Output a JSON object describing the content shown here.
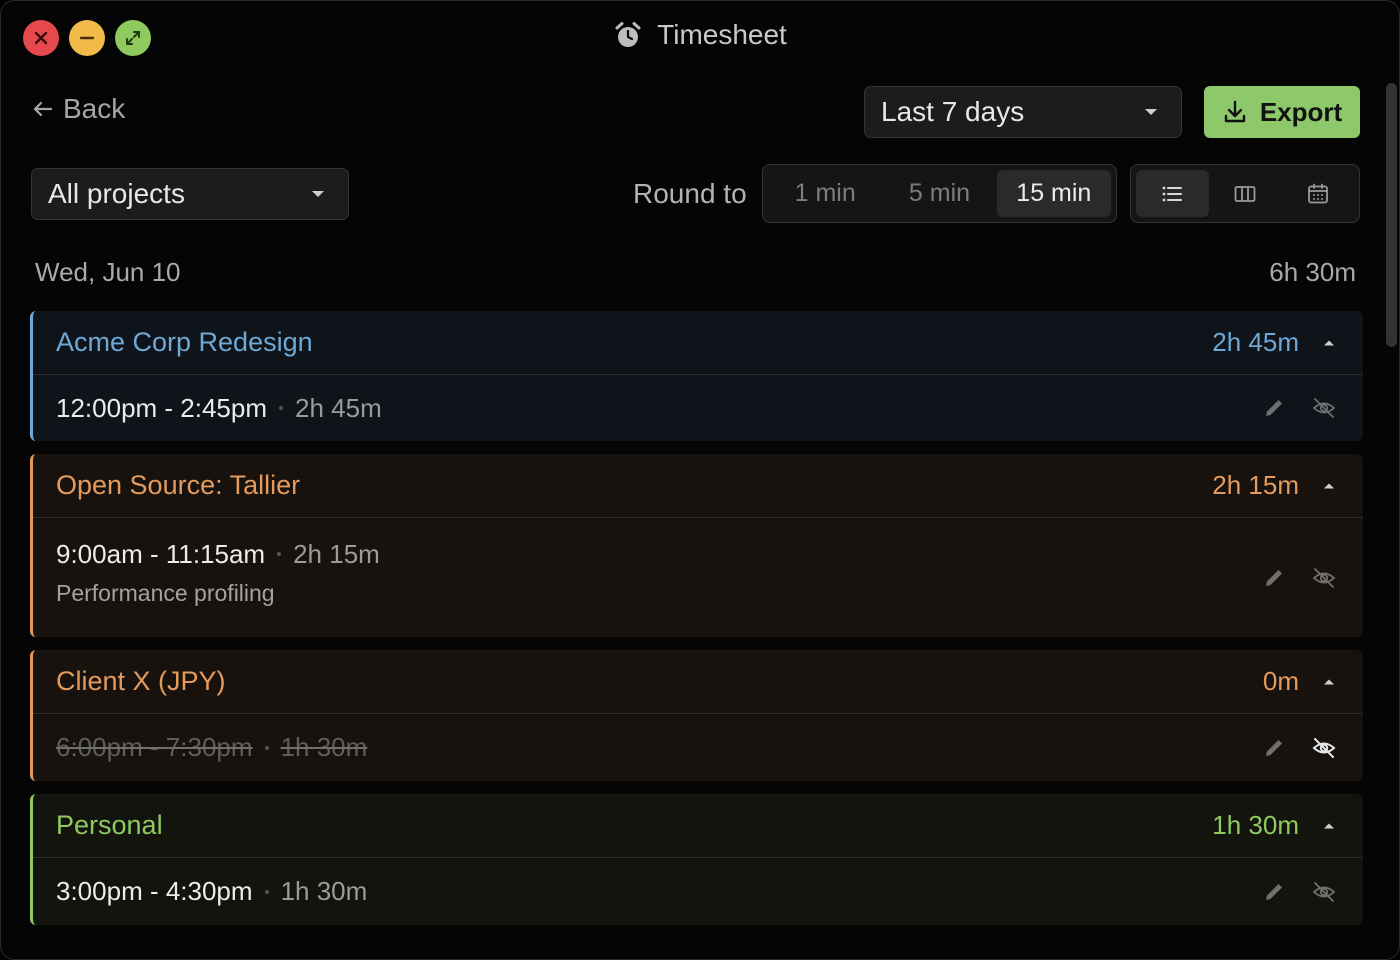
{
  "window": {
    "title": "Timesheet",
    "title_icon": "alarm-clock-icon"
  },
  "toolbar": {
    "back_label": "Back",
    "date_range": "Last 7 days",
    "export_label": "Export",
    "project_filter": "All projects",
    "round_label": "Round to",
    "round_options": [
      "1 min",
      "5 min",
      "15 min"
    ],
    "round_selected": "15 min",
    "views": [
      "list-view-icon",
      "board-view-icon",
      "calendar-view-icon"
    ],
    "view_selected": "list-view-icon"
  },
  "day": {
    "label": "Wed, Jun 10",
    "total": "6h 30m"
  },
  "projects": [
    {
      "name": "Acme Corp Redesign",
      "total": "2h 45m",
      "color": "#6ea8d6",
      "bg": "#0e1419",
      "entries": [
        {
          "time": "12:00pm - 2:45pm",
          "duration": "2h 45m",
          "note": "",
          "hidden": false
        }
      ]
    },
    {
      "name": "Open Source: Tallier",
      "total": "2h 15m",
      "color": "#e49a5c",
      "bg": "#17120d",
      "entries": [
        {
          "time": "9:00am - 11:15am",
          "duration": "2h 15m",
          "note": "Performance profiling",
          "hidden": false
        }
      ]
    },
    {
      "name": "Client X (JPY)",
      "total": "0m",
      "color": "#e49a5c",
      "bg": "#17120d",
      "entries": [
        {
          "time": "6:00pm - 7:30pm",
          "duration": "1h 30m",
          "note": "",
          "hidden": true
        }
      ]
    },
    {
      "name": "Personal",
      "total": "1h 30m",
      "color": "#8fca5f",
      "bg": "#12140d",
      "entries": [
        {
          "time": "3:00pm - 4:30pm",
          "duration": "1h 30m",
          "note": "",
          "hidden": false
        }
      ]
    }
  ]
}
